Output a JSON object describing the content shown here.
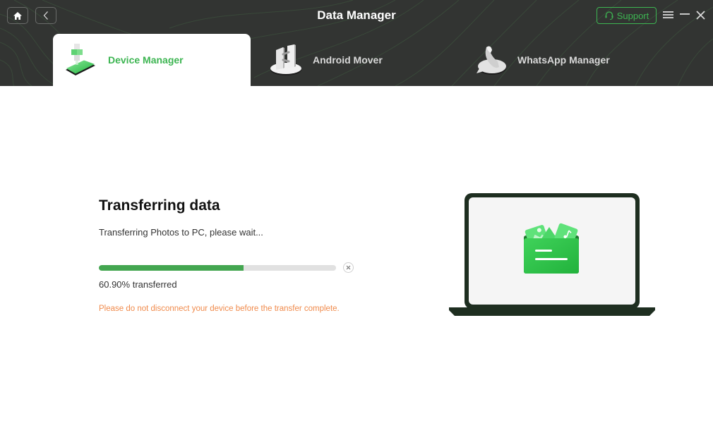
{
  "header": {
    "title": "Data Manager",
    "home_icon": "home-icon",
    "back_icon": "chevron-left-icon",
    "support_label": "Support",
    "support_icon": "headset-icon",
    "menu_icon": "hamburger-menu-icon",
    "minimize_icon": "minimize-icon",
    "close_icon": "close-icon",
    "accent_color": "#3db552"
  },
  "tabs": [
    {
      "label": "Device Manager",
      "icon": "device-manager-icon",
      "active": true
    },
    {
      "label": "Android Mover",
      "icon": "android-mover-icon",
      "active": false
    },
    {
      "label": "WhatsApp Manager",
      "icon": "whatsapp-manager-icon",
      "active": false
    }
  ],
  "transfer": {
    "title": "Transferring data",
    "subtitle": "Transferring Photos to PC, please wait...",
    "progress_percent": 60.9,
    "progress_text": "60.90% transferred",
    "warning": "Please do not disconnect your device before the transfer complete.",
    "warning_color": "#f08a4b",
    "progress_color": "#43a650",
    "cancel_icon": "cancel-x-icon"
  },
  "illustration": {
    "icon": "laptop-folder-illustration"
  }
}
